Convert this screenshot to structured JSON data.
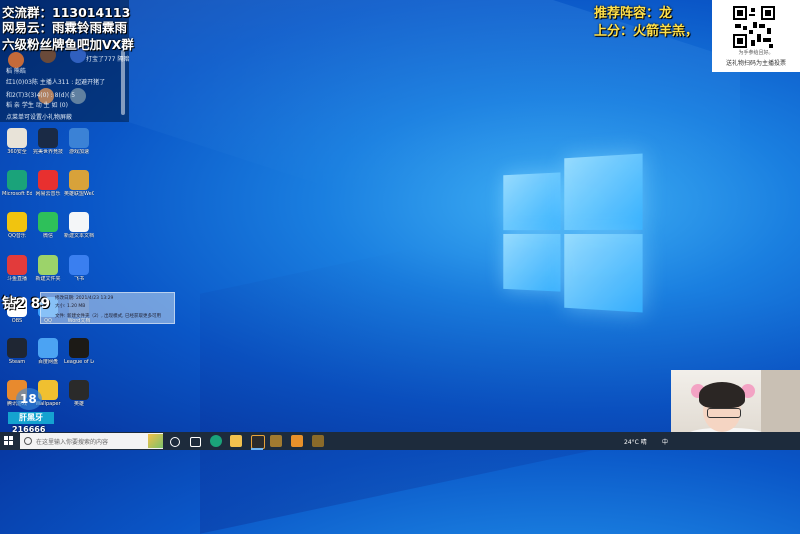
{
  "overlay": {
    "line1": "交流群：113014113",
    "line2": "网易云：雨霖铃雨霖雨",
    "line3": "六级粉丝牌鱼吧加VX群",
    "chat": [
      "打宝了777 隔暗",
      "稻 熊皓",
      "红1(0)03陈 主播人311 : 起避开猪了",
      "和2(T)3(3)4(0) : 8(d)( 5",
      "稻 亲 学生 动 生 如 (0)",
      "点菜单可设置小礼物屏蔽"
    ]
  },
  "top_right": {
    "line1": "推荐阵容：龙",
    "line2": "上分：火箭羊羔，",
    "qr_caption1": "为手参给且好。",
    "qr_caption2": "送礼物扫码为主播投票"
  },
  "desktop_icons": [
    {
      "label": "360安全",
      "color": "#e8e3d8",
      "col": 0,
      "row": 0
    },
    {
      "label": "完美世界竞技平台",
      "color": "#1a2a45",
      "col": 1,
      "row": 0
    },
    {
      "label": "游戏加速",
      "color": "#3b82d6",
      "col": 2,
      "row": 0
    },
    {
      "label": "Microsoft Edge",
      "color": "#1aa37a",
      "col": 0,
      "row": 1
    },
    {
      "label": "网易云音乐",
      "color": "#e8302f",
      "col": 1,
      "row": 1
    },
    {
      "label": "英雄联盟WeGame",
      "color": "#d8a23a",
      "col": 2,
      "row": 1
    },
    {
      "label": "QQ音乐",
      "color": "#f1c40f",
      "col": 0,
      "row": 2
    },
    {
      "label": "微信",
      "color": "#2ec05a",
      "col": 1,
      "row": 2
    },
    {
      "label": "新建文本文档",
      "color": "#f4f6f8",
      "col": 2,
      "row": 2
    },
    {
      "label": "斗鱼直播",
      "color": "#e23b3b",
      "col": 0,
      "row": 3
    },
    {
      "label": "新建文件夹",
      "color": "#9cd36a",
      "col": 1,
      "row": 3
    },
    {
      "label": "飞书",
      "color": "#3a7ff0",
      "col": 2,
      "row": 3
    },
    {
      "label": "OBS",
      "color": "#ffffff",
      "col": 0,
      "row": 4
    },
    {
      "label": "QQ",
      "color": "#3aa0ff",
      "col": 1,
      "row": 4
    },
    {
      "label": "Word文档",
      "color": "#2f5fb3",
      "col": 2,
      "row": 4
    },
    {
      "label": "Steam",
      "color": "#1f2633",
      "col": 0,
      "row": 5
    },
    {
      "label": "百度网盘",
      "color": "#4ba3f3",
      "col": 1,
      "row": 5
    },
    {
      "label": "League of Legends",
      "color": "#1c1a16",
      "col": 2,
      "row": 5
    },
    {
      "label": "腾讯游戏",
      "color": "#e88a2e",
      "col": 0,
      "row": 6
    },
    {
      "label": "Wallpaper",
      "color": "#f0c030",
      "col": 1,
      "row": 6
    },
    {
      "label": "英雄",
      "color": "#2a2a2a",
      "col": 2,
      "row": 6
    }
  ],
  "tooltip": {
    "line1": "修改日期: 2021/4/23 13:29",
    "line2": "大小: 1.20 MB",
    "line3": "文件: 新建文件夹（2）, 出现模式, 已经获取更多可用"
  },
  "coin": "钻2 89",
  "bottom_badge": {
    "circle": "18",
    "label": "肝黑牙",
    "number": "216666"
  },
  "taskbar": {
    "search_placeholder": "在这里输入你要搜索的内容",
    "weather": "24°C 晴",
    "lang": "中"
  }
}
